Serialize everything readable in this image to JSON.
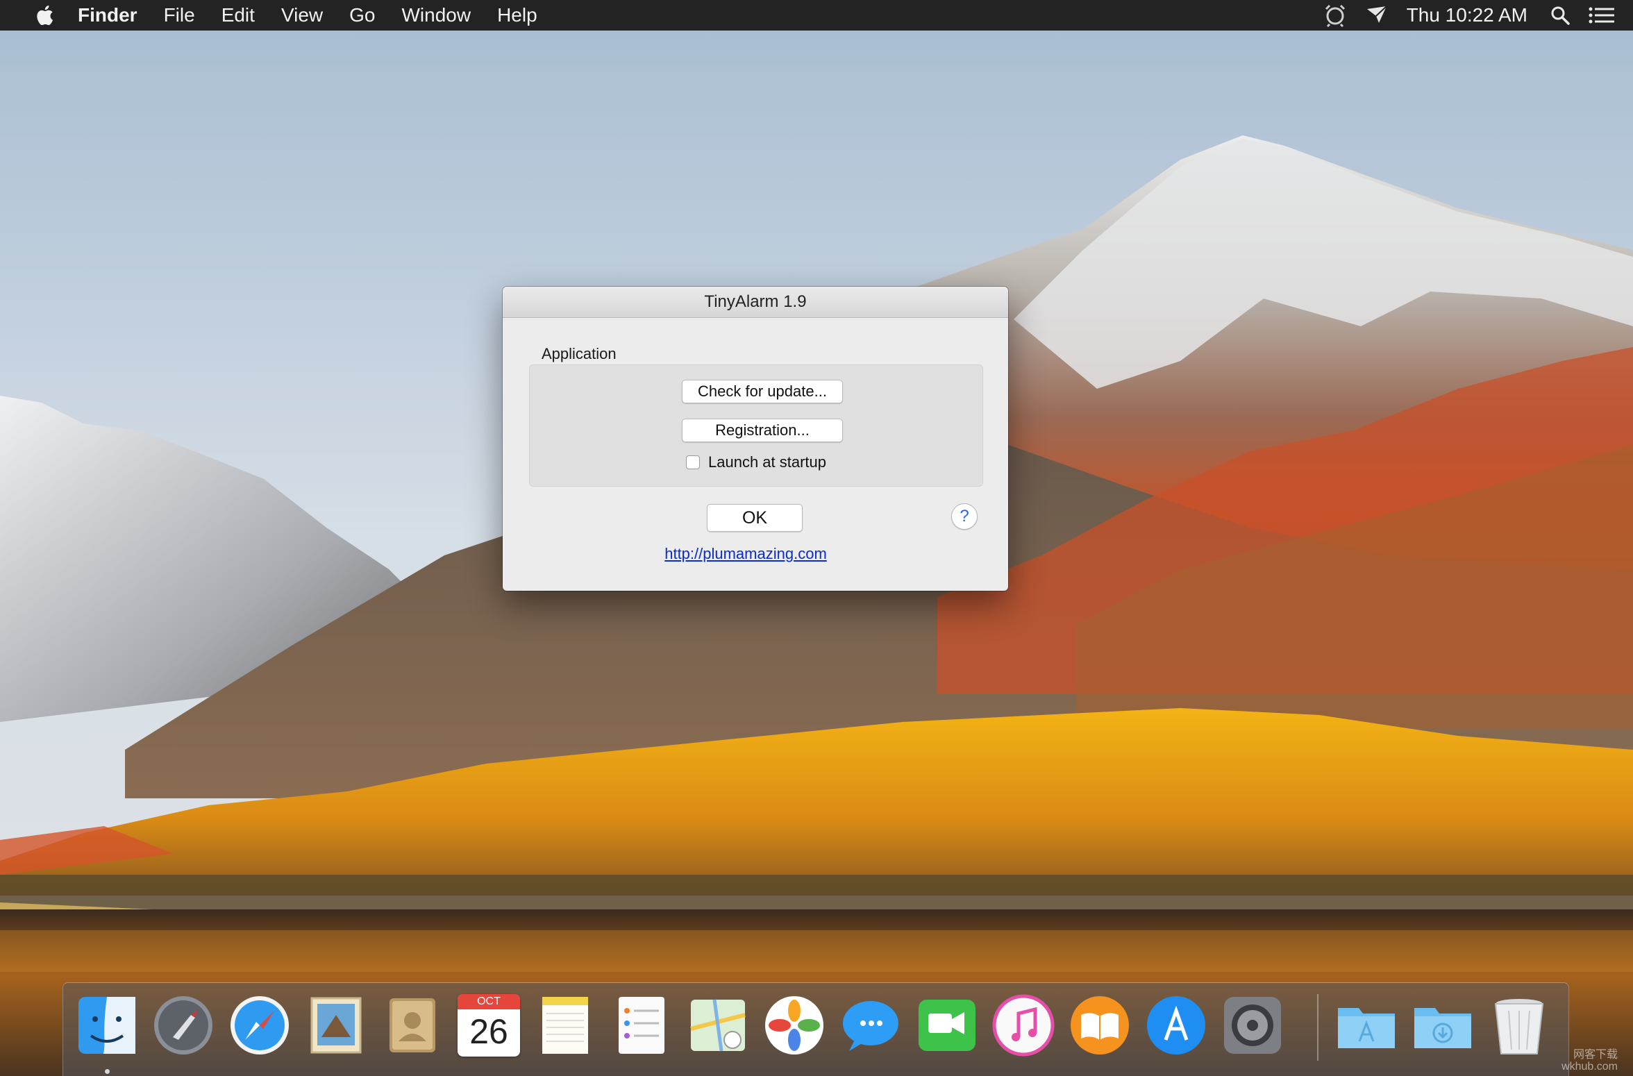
{
  "menubar": {
    "app_name": "Finder",
    "items": [
      "File",
      "Edit",
      "View",
      "Go",
      "Window",
      "Help"
    ],
    "clock": "Thu 10:22 AM",
    "status_icons": [
      "alarm-clock-icon",
      "airplay-icon",
      "search-icon",
      "notification-center-icon"
    ]
  },
  "dialog": {
    "title": "TinyAlarm 1.9",
    "group_label": "Application",
    "check_update_label": "Check for update...",
    "registration_label": "Registration...",
    "launch_startup_label": "Launch at startup",
    "launch_startup_checked": false,
    "ok_label": "OK",
    "help_label": "?",
    "link": "http://plumamazing.com"
  },
  "dock": {
    "calendar_month": "OCT",
    "calendar_day": "26",
    "apps": [
      "finder-icon",
      "launchpad-icon",
      "safari-icon",
      "mail-icon",
      "contacts-icon",
      "calendar-icon",
      "notes-icon",
      "reminders-icon",
      "maps-icon",
      "photos-icon",
      "messages-icon",
      "facetime-icon",
      "itunes-icon",
      "ibooks-icon",
      "app-store-icon",
      "system-preferences-icon"
    ],
    "stack_items": [
      "applications-folder-icon",
      "downloads-folder-icon",
      "trash-icon"
    ]
  },
  "watermark": {
    "line1": "网客下载",
    "line2": "wkhub.com"
  },
  "colors": {
    "menubar": "#232323",
    "dialog_bg": "#ececec",
    "link": "#0c2ccf",
    "help": "#2a6ad8"
  }
}
